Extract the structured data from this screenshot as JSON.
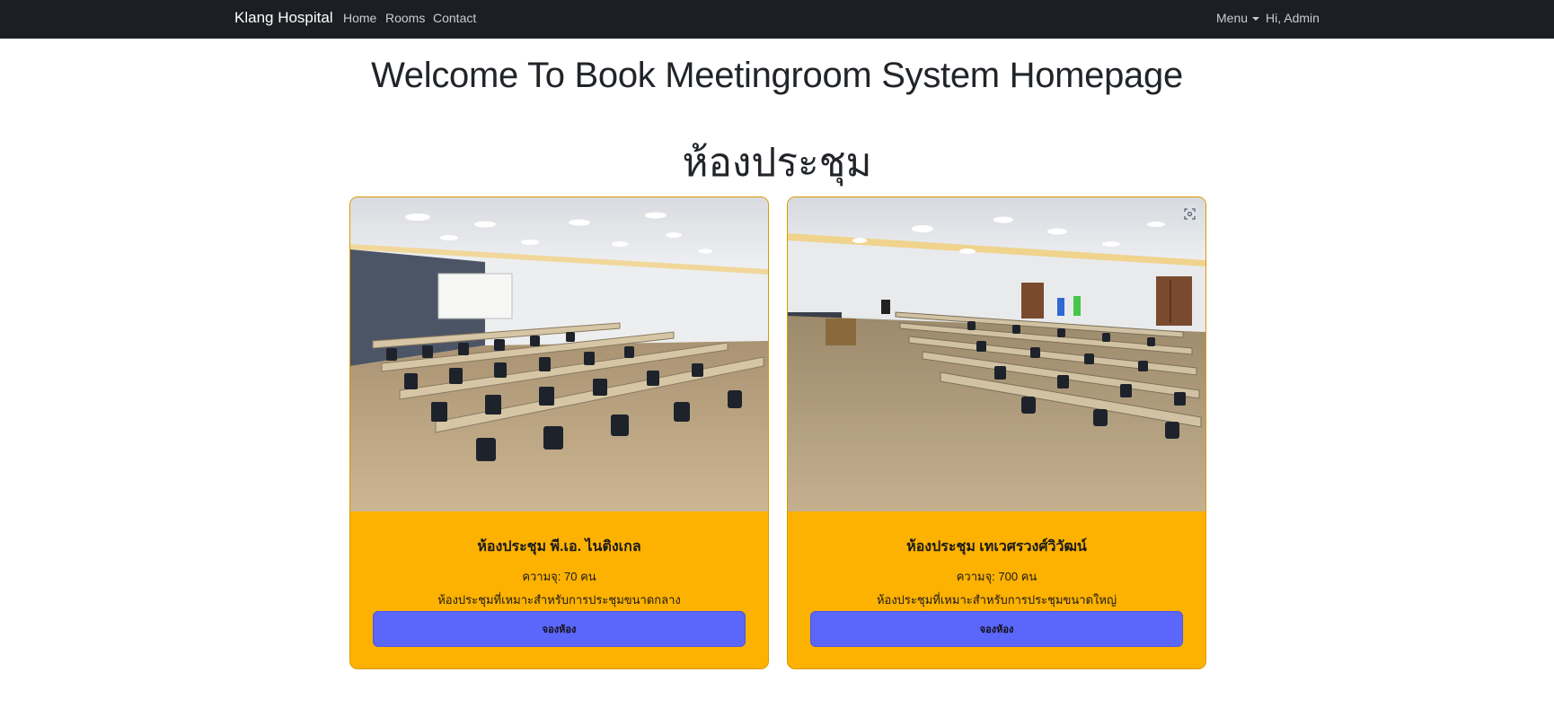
{
  "navbar": {
    "brand": "Klang Hospital",
    "links": [
      "Home",
      "Rooms",
      "Contact"
    ],
    "menu_label": "Menu",
    "greeting": "Hi, Admin"
  },
  "page": {
    "welcome": "Welcome To Book Meetingroom System Homepage",
    "section_title": "ห้องประชุม"
  },
  "rooms": [
    {
      "name": "ห้องประชุม พี.เอ. ไนติงเกล",
      "capacity": "ความจุ: 70 คน",
      "description": "ห้องประชุมที่เหมาะสำหรับการประชุมขนาดกลาง",
      "button": "จองห้อง"
    },
    {
      "name": "ห้องประชุม เทเวศรวงศ์วิวัฒน์",
      "capacity": "ความจุ: 700 คน",
      "description": "ห้องประชุมที่เหมาะสำหรับการประชุมขนาดใหญ่",
      "button": "จองห้อง"
    }
  ],
  "colors": {
    "navbar_bg": "#1b1f23",
    "card_bg": "#fdb100",
    "button_bg": "#5b66fb"
  }
}
